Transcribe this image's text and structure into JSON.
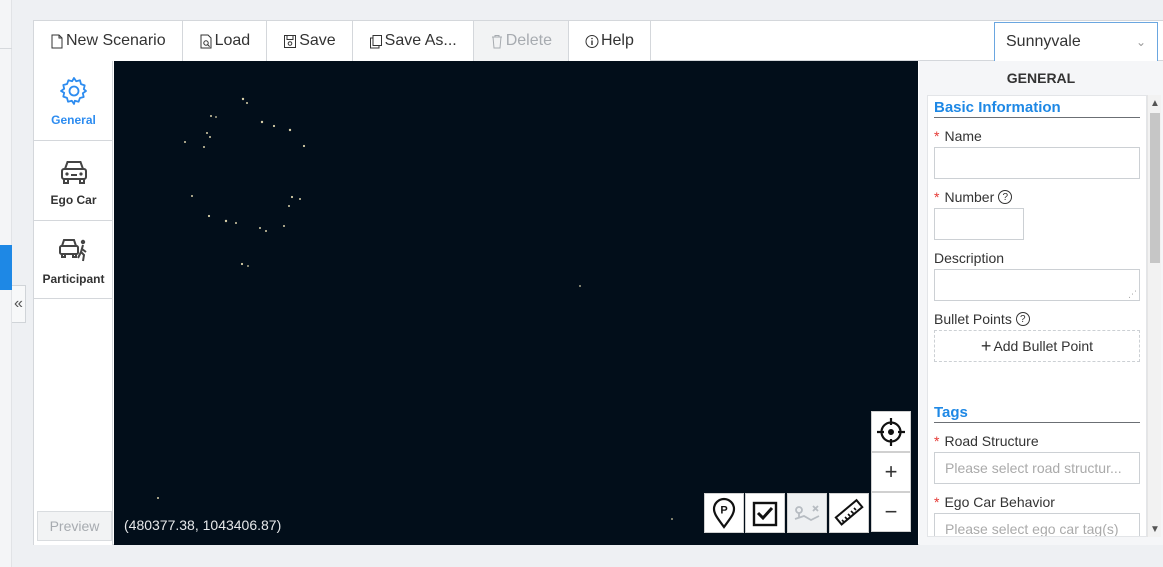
{
  "toolbar": {
    "new_label": "New Scenario",
    "load_label": "Load",
    "save_label": "Save",
    "save_as_label": "Save As...",
    "delete_label": "Delete",
    "help_label": "Help"
  },
  "city_select": {
    "value": "Sunnyvale"
  },
  "nav": {
    "items": [
      {
        "label": "General",
        "icon": "gear-icon",
        "active": true
      },
      {
        "label": "Ego Car",
        "icon": "car-icon",
        "active": false
      },
      {
        "label": "Participant",
        "icon": "participant-icon",
        "active": false
      }
    ],
    "preview_label": "Preview"
  },
  "map": {
    "coordinates": "(480377.38, 1043406.87)",
    "zoom_in": "+",
    "zoom_out": "−",
    "tools": [
      "parking-pin-icon",
      "checkbox-icon",
      "route-icon",
      "ruler-icon"
    ]
  },
  "props": {
    "title": "GENERAL",
    "basic_info": {
      "heading": "Basic Information",
      "name_label": "Name",
      "number_label": "Number",
      "description_label": "Description",
      "bullet_label": "Bullet Points",
      "add_bullet": "Add Bullet Point"
    },
    "tags": {
      "heading": "Tags",
      "road_label": "Road Structure",
      "road_placeholder": "Please select road structur...",
      "ego_label": "Ego Car Behavior",
      "ego_placeholder": "Please select ego car tag(s)"
    }
  },
  "colors": {
    "accent": "#1e88e5",
    "map_bg": "#020e1a",
    "required": "#e53935"
  }
}
